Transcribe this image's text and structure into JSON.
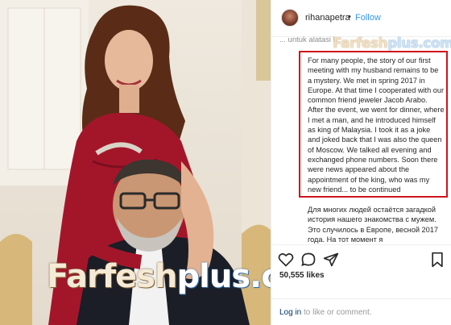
{
  "header": {
    "username": "rihanapetra",
    "separator": "•",
    "follow_label": "Follow"
  },
  "caption": {
    "previous_fragment": "... untuk alatasi h",
    "english": "For many people, the story of our first meeting with my husband remains to be a mystery. We met in spring 2017 in Europe. At that time I cooperated with our common friend jeweler Jacob Arabo. After the event, we went for dinner, where I met a man, and he introduced himself as king of Malaysia. I took it as a joke and joked back that I was also the queen of Moscow. We talked all evening and exchanged phone numbers. Soon there were news appeared about the appointment of the king, who was my new friend... to be continued",
    "russian": "Для многих людей остаётся загадкой история нашего знакомства с мужем. Это случилось в Европе, весной 2017 года. На тот момент я"
  },
  "actions": {
    "like_icon": "heart-icon",
    "comment_icon": "comment-icon",
    "share_icon": "share-icon",
    "save_icon": "bookmark-icon"
  },
  "likes": "50,555 likes",
  "footer": {
    "login_link": "Log in",
    "login_rest": " to like or comment."
  },
  "watermark": {
    "part1": "Farfesh",
    "part2": "plus",
    "suffix": ".com"
  },
  "colors": {
    "accent_blue": "#3897f0",
    "highlight_red": "#d0141b",
    "dress_red": "#a3162a"
  }
}
